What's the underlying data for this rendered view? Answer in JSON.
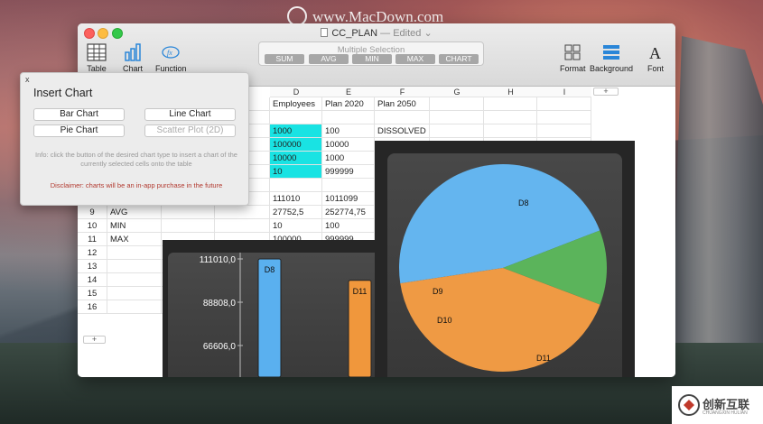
{
  "watermark": {
    "text": "www.MacDown.com"
  },
  "window": {
    "title": "CC_PLAN",
    "status": "— Edited",
    "toolbar": {
      "table": "Table",
      "chart": "Chart",
      "function": "Function",
      "format": "Format",
      "background": "Background",
      "font": "Font"
    },
    "selection": {
      "label": "Multiple Selection",
      "buttons": [
        "SUM",
        "AVG",
        "MIN",
        "MAX",
        "CHART"
      ]
    }
  },
  "sheet": {
    "columns": [
      "D",
      "E",
      "F",
      "G",
      "H",
      "I"
    ],
    "add_column": "+",
    "add_row": "+",
    "rows": [
      {
        "num": "",
        "b": "",
        "c": "",
        "d": "Employees",
        "e": "Plan 2020",
        "f": "Plan 2050"
      },
      {
        "num": "",
        "b": "",
        "c": "",
        "d": "",
        "e": "",
        "f": ""
      },
      {
        "num": "",
        "b": "",
        "c": "y",
        "d": "1000",
        "e": "100",
        "f": "DISSOLVED"
      },
      {
        "num": "",
        "b": "",
        "c": "",
        "d": "100000",
        "e": "10000",
        "f": "DISSOLVED"
      },
      {
        "num": "",
        "b": "",
        "c": "",
        "d": "10000",
        "e": "1000",
        "f": ""
      },
      {
        "num": "",
        "b": "",
        "c": "",
        "d": "10",
        "e": "999999",
        "f": ""
      },
      {
        "num": "",
        "b": "",
        "c": "",
        "d": "",
        "e": "",
        "f": ""
      },
      {
        "num": "",
        "b": "",
        "c": "",
        "d": "111010",
        "e": "1011099",
        "f": ""
      },
      {
        "num": "9",
        "b": "AVG",
        "c": "",
        "d": "27752,5",
        "e": "252774,75",
        "f": ""
      },
      {
        "num": "10",
        "b": "MIN",
        "c": "",
        "d": "10",
        "e": "100",
        "f": ""
      },
      {
        "num": "11",
        "b": "MAX",
        "c": "",
        "d": "100000",
        "e": "999999",
        "f": ""
      },
      {
        "num": "12",
        "b": "",
        "c": "",
        "d": "",
        "e": "",
        "f": ""
      },
      {
        "num": "13",
        "b": "",
        "c": "",
        "d": "",
        "e": "",
        "f": ""
      },
      {
        "num": "14",
        "b": "",
        "c": "",
        "d": "",
        "e": "",
        "f": ""
      },
      {
        "num": "15",
        "b": "",
        "c": "",
        "d": "",
        "e": "",
        "f": ""
      },
      {
        "num": "16",
        "b": "",
        "c": "",
        "d": "",
        "e": "",
        "f": ""
      }
    ]
  },
  "popup": {
    "close": "x",
    "title": "Insert Chart",
    "bar_chart": "Bar Chart",
    "line_chart": "Line Chart",
    "pie_chart": "Pie Chart",
    "scatter_plot": "Scatter Plot (2D)",
    "info": "Info: click the button of the desired chart type to insert a chart of the currently selected cells onto the table",
    "disclaimer": "Disclaimer: charts will be an in-app purchase in the future"
  },
  "bar_chart": {
    "ticks": [
      "111010,0",
      "88808,0",
      "66606,0"
    ],
    "bars": [
      {
        "label": "D8",
        "value": 111010,
        "color": "#5ab0ef"
      },
      {
        "label": "D11",
        "value": 100000,
        "color": "#f0973c"
      }
    ]
  },
  "pie_chart": {
    "slices": [
      {
        "label": "D8",
        "value": 111010,
        "color": "#64b5ef"
      },
      {
        "label": "D9",
        "value": 27752.5,
        "color": "#5bb45b"
      },
      {
        "label": "D10",
        "value": 10,
        "color": "#5bb45b"
      },
      {
        "label": "D11",
        "value": 100000,
        "color": "#ef9a44"
      }
    ]
  },
  "badge": {
    "text": "创新互联",
    "sub": "CHUANGXIN HULIAN"
  }
}
